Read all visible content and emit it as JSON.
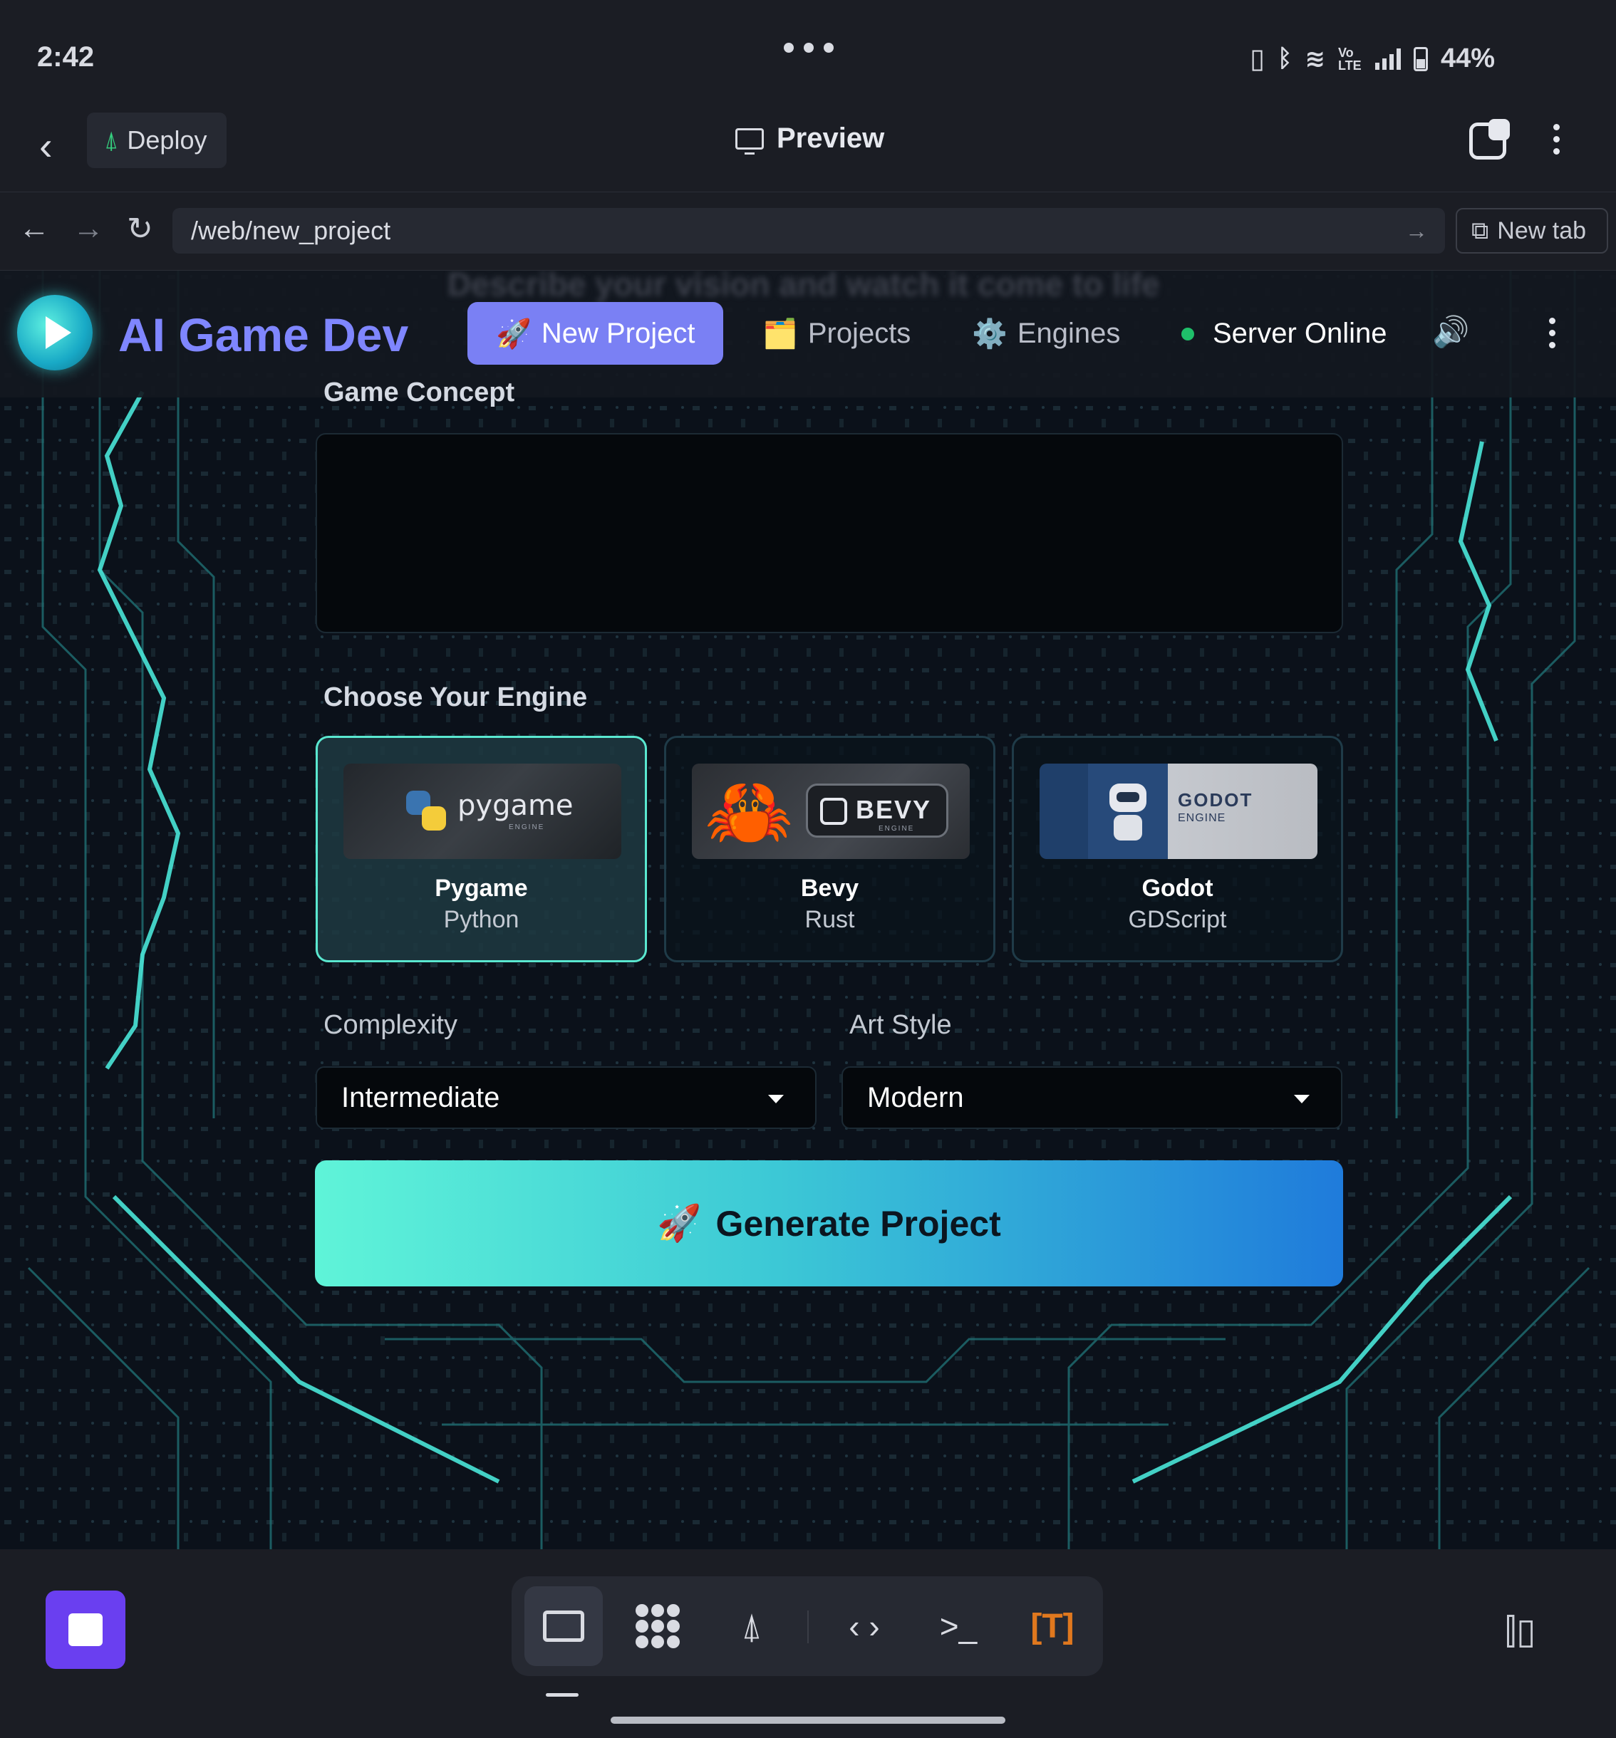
{
  "status_bar": {
    "time": "2:42",
    "battery": "44%",
    "network": "Vo LTE"
  },
  "app_toolbar": {
    "deploy_label": "Deploy",
    "preview_label": "Preview"
  },
  "url_bar": {
    "url": "/web/new_project",
    "new_tab_label": "New tab"
  },
  "app": {
    "brand": "AI Game Dev",
    "tagline_faded": "Describe your vision and watch it come to life",
    "nav": [
      {
        "icon": "🚀",
        "label": "New Project",
        "active": true
      },
      {
        "icon": "🗂️",
        "label": "Projects",
        "active": false
      },
      {
        "icon": "⚙️",
        "label": "Engines",
        "active": false
      }
    ],
    "server_status": "Server Online",
    "server_status_color": "#1fbf6a"
  },
  "form": {
    "concept_label": "Game Concept",
    "concept_value": "",
    "engine_heading": "Choose Your Engine",
    "engines": [
      {
        "name": "Pygame",
        "language": "Python",
        "logo_text": "pygame",
        "logo_sub": "ENGINE",
        "selected": true
      },
      {
        "name": "Bevy",
        "language": "Rust",
        "logo_text": "BEVY",
        "logo_sub": "ENGINE",
        "selected": false
      },
      {
        "name": "Godot",
        "language": "GDScript",
        "logo_text": "GODOT",
        "logo_sub": "ENGINE",
        "selected": false
      }
    ],
    "complexity_label": "Complexity",
    "complexity_value": "Intermediate",
    "art_style_label": "Art Style",
    "art_style_value": "Modern",
    "generate_icon": "🚀",
    "generate_label": "Generate Project"
  },
  "colors": {
    "accent": "#7a80f4",
    "brand": "#7f86ff",
    "selected_border": "#5ae8d0",
    "generate_gradient_start": "#5ff4d8",
    "generate_gradient_end": "#1f7bdb",
    "stop_button": "#6a3ff0",
    "terminal_t": "#e0781e"
  },
  "bottom_bar": {
    "dock_icons": [
      "monitor-icon",
      "workflow-icon",
      "deploy-icon",
      "code-icon",
      "terminal-icon",
      "template-icon"
    ],
    "active_index": 0,
    "template_label": "[T]"
  }
}
